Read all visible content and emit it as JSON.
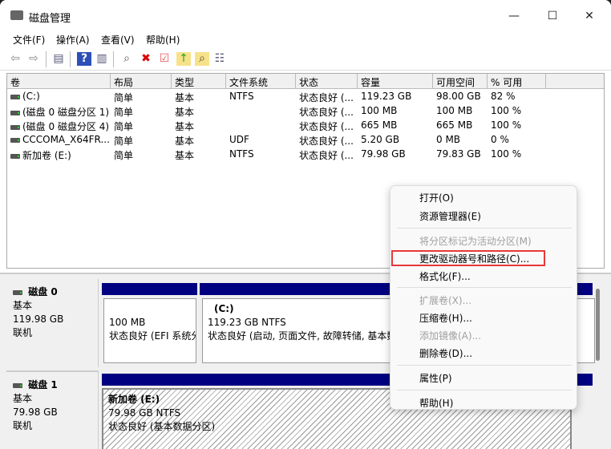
{
  "window": {
    "title": "磁盘管理",
    "minimize": "—",
    "maximize": "☐",
    "close": "✕"
  },
  "menu": [
    "文件(F)",
    "操作(A)",
    "查看(V)",
    "帮助(H)"
  ],
  "toolbar": [
    "back-icon",
    "forward-icon",
    "console-tree-icon",
    "help-icon",
    "action-pane-icon",
    "connect-drive-icon",
    "delete-icon",
    "check-icon",
    "folder-up-icon",
    "folder-search-icon",
    "properties-list-icon"
  ],
  "table": {
    "columns": [
      "卷",
      "布局",
      "类型",
      "文件系统",
      "状态",
      "容量",
      "可用空间",
      "% 可用"
    ],
    "rows": [
      [
        "(C:)",
        "简单",
        "基本",
        "NTFS",
        "状态良好 (...",
        "119.23 GB",
        "98.00 GB",
        "82 %"
      ],
      [
        "(磁盘 0 磁盘分区 1)",
        "简单",
        "基本",
        "",
        "状态良好 (...",
        "100 MB",
        "100 MB",
        "100 %"
      ],
      [
        "(磁盘 0 磁盘分区 4)",
        "简单",
        "基本",
        "",
        "状态良好 (...",
        "665 MB",
        "665 MB",
        "100 %"
      ],
      [
        "CCCOMA_X64FR...",
        "简单",
        "基本",
        "UDF",
        "状态良好 (...",
        "5.20 GB",
        "0 MB",
        "0 %"
      ],
      [
        "新加卷 (E:)",
        "简单",
        "基本",
        "NTFS",
        "状态良好 (...",
        "79.98 GB",
        "79.83 GB",
        "100 %"
      ]
    ]
  },
  "disks": [
    {
      "name": "磁盘 0",
      "type": "基本",
      "size": "119.98 GB",
      "status": "联机",
      "partitions": [
        {
          "label": "",
          "size": "100 MB",
          "status": "状态良好 (EFI 系统分区)"
        },
        {
          "label": "(C:)",
          "size": "119.23 GB NTFS",
          "status": "状态良好 (启动, 页面文件, 故障转储, 基本数据分区)"
        }
      ]
    },
    {
      "name": "磁盘 1",
      "type": "基本",
      "size": "79.98 GB",
      "status": "联机",
      "partitions": [
        {
          "label": "新加卷  (E:)",
          "size": "79.98 GB NTFS",
          "status": "状态良好 (基本数据分区)"
        }
      ]
    }
  ],
  "context_menu": {
    "items": [
      {
        "label": "打开(O)",
        "enabled": true
      },
      {
        "label": "资源管理器(E)",
        "enabled": true
      },
      {
        "label": "将分区标记为活动分区(M)",
        "enabled": false
      },
      {
        "label": "更改驱动器号和路径(C)...",
        "enabled": true,
        "highlighted": true
      },
      {
        "label": "格式化(F)...",
        "enabled": true
      },
      {
        "label": "扩展卷(X)...",
        "enabled": false
      },
      {
        "label": "压缩卷(H)...",
        "enabled": true
      },
      {
        "label": "添加镜像(A)...",
        "enabled": false
      },
      {
        "label": "删除卷(D)...",
        "enabled": true
      },
      {
        "label": "属性(P)",
        "enabled": true
      },
      {
        "label": "帮助(H)",
        "enabled": true
      }
    ]
  },
  "colors": {
    "partition_bar": "#000080",
    "highlight_border": "#e83838"
  }
}
